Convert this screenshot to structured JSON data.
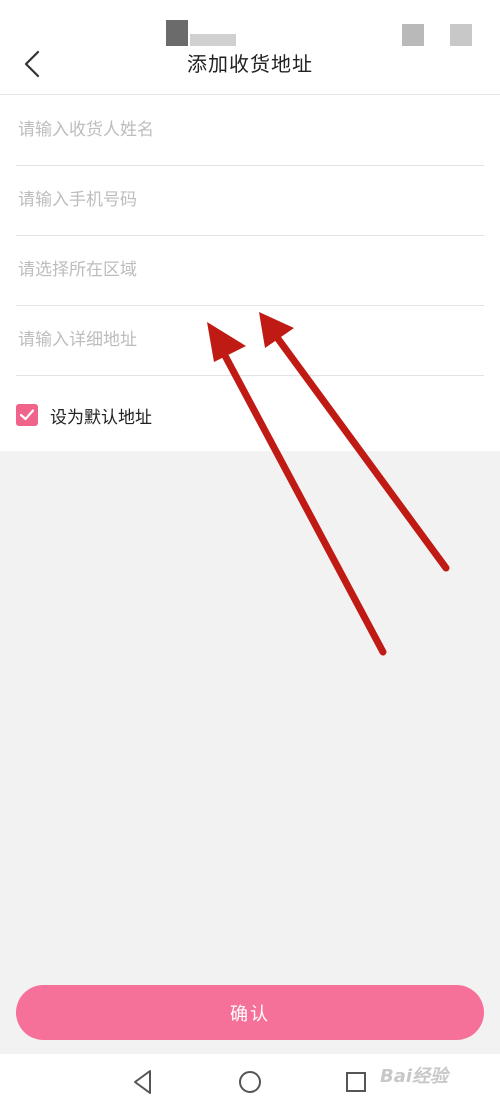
{
  "header": {
    "title": "添加收货地址",
    "back_icon": "chevron-left-icon"
  },
  "form": {
    "fields": [
      {
        "placeholder": "请输入收货人姓名",
        "value": ""
      },
      {
        "placeholder": "请输入手机号码",
        "value": ""
      },
      {
        "placeholder": "请选择所在区域",
        "value": ""
      },
      {
        "placeholder": "请输入详细地址",
        "value": ""
      }
    ],
    "default_checkbox": {
      "label": "设为默认地址",
      "checked": true,
      "icon": "check-icon"
    }
  },
  "footer": {
    "confirm_label": "确认"
  },
  "navbar": {
    "icons": [
      "back-triangle-icon",
      "home-circle-icon",
      "recents-square-icon"
    ]
  },
  "watermark": "Bai经验",
  "colors": {
    "accent": "#f0648c",
    "button": "#f57199",
    "annotation_arrow": "#c01a14"
  }
}
